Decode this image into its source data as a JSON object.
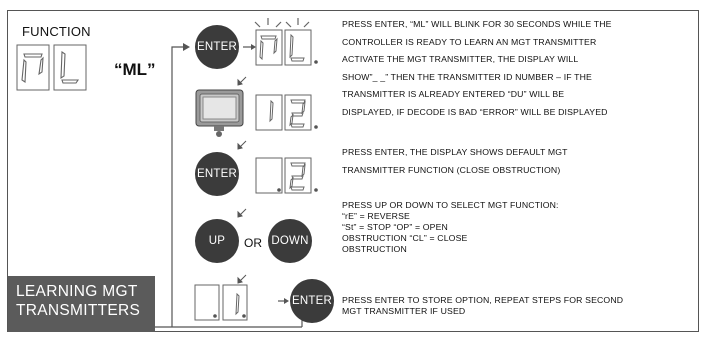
{
  "panel": {
    "function_label": "FUNCTION",
    "function_code": "“ML”",
    "title_lines": [
      "LEARNING MGT",
      "TRANSMITTERS"
    ]
  },
  "buttons": {
    "enter": "ENTER",
    "up": "UP",
    "or": "OR",
    "down": "DOWN"
  },
  "steps": [
    {
      "lines": [
        "PRESS ENTER, “ML” WILL BLINK FOR 30 SECONDS WHILE THE",
        "CONTROLLER IS READY TO LEARN AN MGT TRANSMITTER",
        "ACTIVATE THE MGT TRANSMITTER, THE DISPLAY WILL",
        "SHOW”_ _” THEN THE TRANSMITTER ID NUMBER – IF THE",
        "TRANSMITTER IS ALREADY ENTERED “DU” WILL BE",
        "DISPLAYED, IF DECODE IS BAD “ERROR” WILL BE DISPLAYED"
      ]
    },
    {
      "lines": [
        "PRESS ENTER, THE DISPLAY SHOWS DEFAULT MGT",
        "TRANSMITTER FUNCTION (CLOSE OBSTRUCTION)"
      ]
    },
    {
      "lines": [
        "PRESS UP OR DOWN TO SELECT MGT FUNCTION:",
        "“rE” = REVERSE",
        "“St” = STOP “OP” = OPEN",
        "OBSTRUCTION “CL” = CLOSE",
        "OBSTRUCTION"
      ]
    },
    {
      "lines": [
        "PRESS ENTER TO STORE OPTION, REPEAT STEPS FOR SECOND",
        "MGT TRANSMITTER IF USED"
      ]
    }
  ],
  "icons": {
    "transmitter": "mgt-transmitter-device-icon",
    "arrow": "arrow-icon",
    "blink": "blink-rays-icon"
  },
  "colors": {
    "button": "#3b3b3b",
    "title_box": "#5b5b5b",
    "line": "#555555"
  }
}
